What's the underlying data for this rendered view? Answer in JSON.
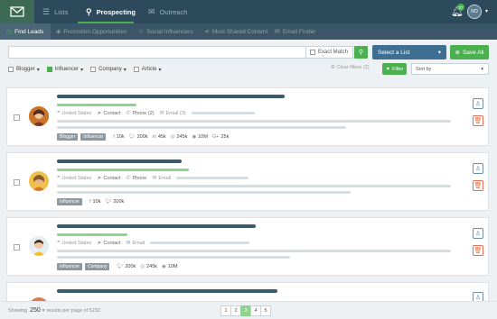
{
  "nav": {
    "tabs": [
      {
        "label": "Lists",
        "icon": "list-icon"
      },
      {
        "label": "Prospecting",
        "icon": "search-icon"
      },
      {
        "label": "Outreach",
        "icon": "envelope-icon"
      }
    ],
    "active_tab": "Prospecting",
    "notifications_count": "37",
    "user_initials": "NO"
  },
  "subnav": {
    "tabs": [
      {
        "label": "Find Leads"
      },
      {
        "label": "Promotion Opportunities"
      },
      {
        "label": "Social Influencers"
      },
      {
        "label": "Most Shared Content"
      },
      {
        "label": "Email Finder"
      }
    ],
    "active_tab": "Find Leads"
  },
  "search": {
    "value": "",
    "exact_match_label": "Exact Match",
    "select_list_label": "Select a List",
    "save_all_label": "Save All"
  },
  "filters": {
    "items": [
      {
        "label": "Blogger",
        "checked": false
      },
      {
        "label": "Influencer",
        "checked": true
      },
      {
        "label": "Company",
        "checked": false
      },
      {
        "label": "Article",
        "checked": false
      }
    ],
    "clear_label": "Clear filters (2)",
    "filter_button_label": "Filter",
    "sort_label": "Sort by"
  },
  "leads": [
    {
      "location": "United States",
      "contact_label": "Contact",
      "phone_label": "Phone (2)",
      "email_label": "Email (3)",
      "tags": [
        "Blogger",
        "Influencer"
      ],
      "stats": [
        {
          "icon": "facebook-icon",
          "value": "10k"
        },
        {
          "icon": "twitter-icon",
          "value": "200k"
        },
        {
          "icon": "linkedin-icon",
          "value": "45k"
        },
        {
          "icon": "pinterest-icon",
          "value": "245k"
        },
        {
          "icon": "instagram-icon",
          "value": "10M"
        },
        {
          "icon": "google-plus-icon",
          "value": "25k"
        }
      ]
    },
    {
      "location": "United States",
      "contact_label": "Contact",
      "phone_label": "Phone",
      "email_label": "Email",
      "tags": [
        "Influencer"
      ],
      "stats": [
        {
          "icon": "facebook-icon",
          "value": "10k"
        },
        {
          "icon": "twitter-icon",
          "value": "200k"
        }
      ]
    },
    {
      "location": "United States",
      "contact_label": "Contact",
      "email_label": "Email",
      "tags": [
        "Influencer",
        "Company"
      ],
      "stats": [
        {
          "icon": "twitter-icon",
          "value": "200k"
        },
        {
          "icon": "pinterest-icon",
          "value": "245k"
        },
        {
          "icon": "instagram-icon",
          "value": "10M"
        }
      ]
    }
  ],
  "footer": {
    "showing_label": "Showing",
    "per_page": "250",
    "results_text": "results per page of 5232",
    "pages": [
      "1",
      "2",
      "3",
      "4",
      "5"
    ],
    "current_page": "3"
  },
  "colors": {
    "nav_bg": "#2c4a5c",
    "subnav_bg": "#3b5666",
    "accent_green": "#4caf50",
    "select_blue": "#3e6f92",
    "delete_orange": "#e4704f"
  }
}
